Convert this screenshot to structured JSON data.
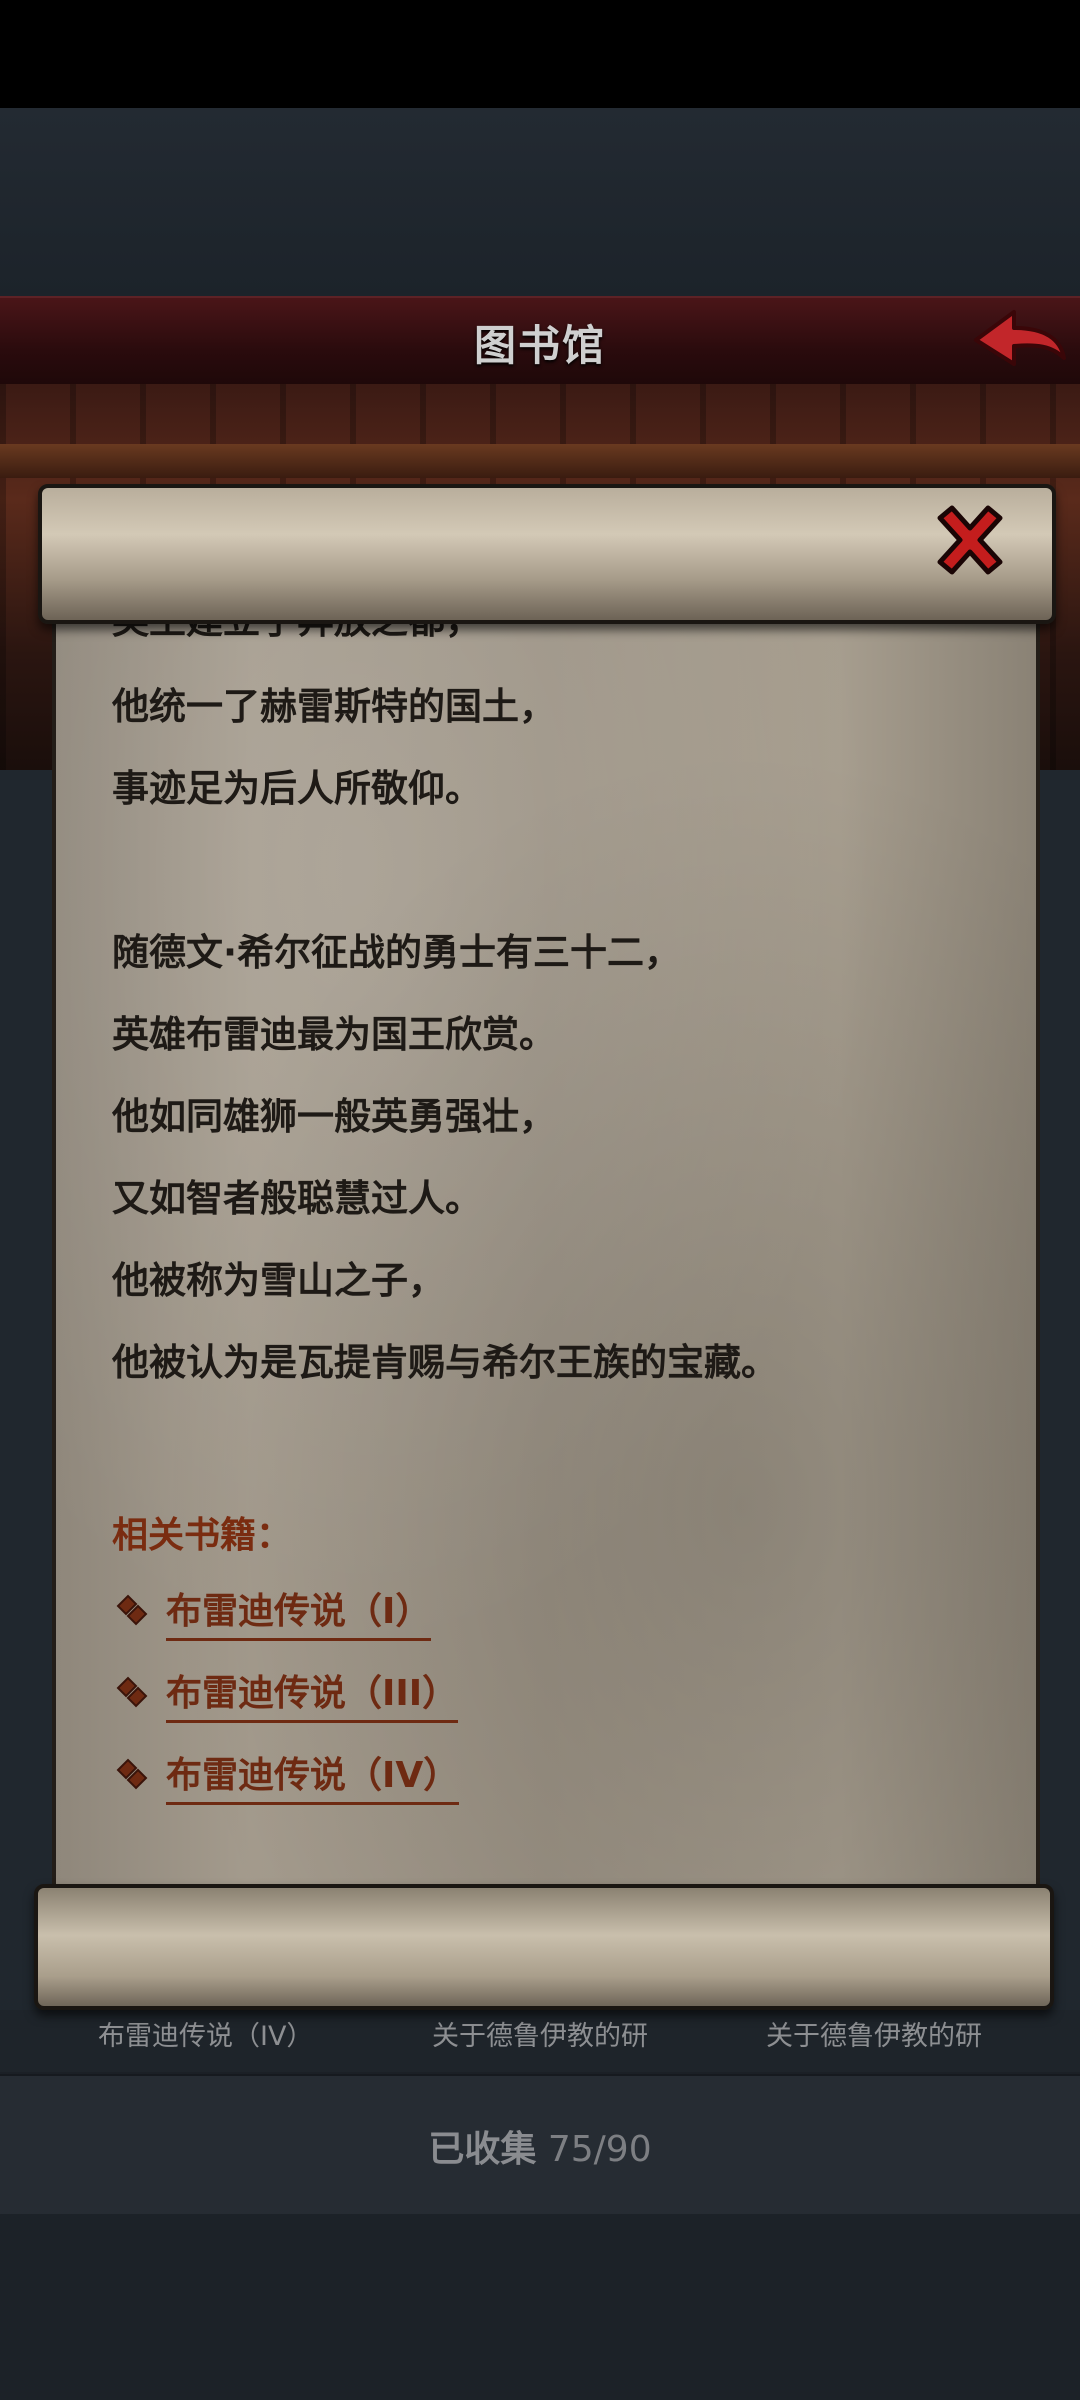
{
  "header": {
    "title": "图书馆"
  },
  "book": {
    "lines": [
      "英王建立了奔放之都，",
      "他统一了赫雷斯特的国土，",
      "事迹足为后人所敬仰。",
      "",
      "随德文·希尔征战的勇士有三十二，",
      "英雄布雷迪最为国王欣赏。",
      "他如同雄狮一般英勇强壮，",
      "又如智者般聪慧过人。",
      "他被称为雪山之子，",
      "他被认为是瓦提肯赐与希尔王族的宝藏。"
    ],
    "related_heading": "相关书籍：",
    "related_books": [
      "布雷迪传说（I）",
      "布雷迪传说（III）",
      "布雷迪传说（IV）"
    ]
  },
  "tabs": [
    "布雷迪传说（IV）",
    "关于德鲁伊教的研",
    "关于德鲁伊教的研"
  ],
  "footer": {
    "collected_label": "已收集",
    "collected_value": "75/90"
  },
  "icons": {
    "close": "close-x-icon",
    "back": "back-arrow-icon",
    "link": "book-link-icon"
  },
  "colors": {
    "title_bar": "#4a1518",
    "link": "#6e2a12",
    "close": "#c41d1d"
  }
}
